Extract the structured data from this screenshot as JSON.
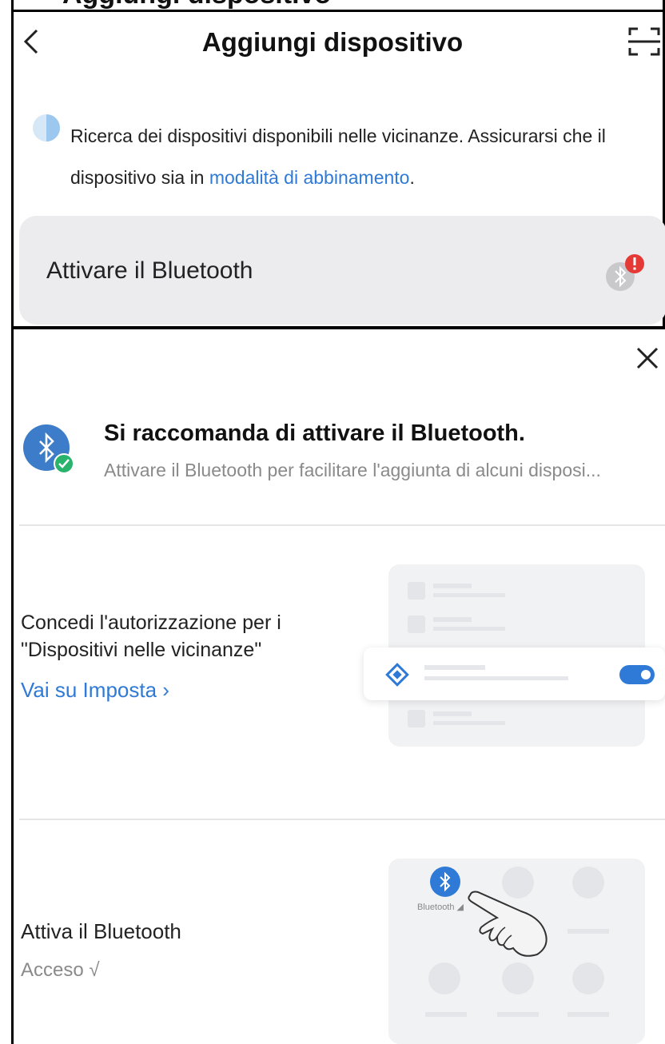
{
  "header": {
    "title": "Aggiungi dispositivo",
    "partial_top_text": "Aggiungi dispositivo"
  },
  "info": {
    "text_before": "Ricerca dei dispositivi disponibili nelle vicinanze. Assicurarsi che il dispositivo sia in ",
    "link": "modalità di abbinamento",
    "text_after": "."
  },
  "bt_card": {
    "label": "Attivare il Bluetooth"
  },
  "sheet": {
    "rec_title": "Si raccomanda di attivare il Bluetooth.",
    "rec_subtitle": "Attivare il Bluetooth per facilitare l'aggiunta di alcuni disposi...",
    "permission": {
      "title": "Concedi l'autorizzazione per i \"Dispositivi nelle vicinanze\"",
      "link": "Vai su Imposta"
    },
    "bluetooth": {
      "title": "Attiva il Bluetooth",
      "status": "Acceso",
      "illustration_label": "Bluetooth"
    }
  },
  "colors": {
    "accent": "#2f7ad6",
    "card_bg": "#ececee",
    "alert": "#e53935",
    "success": "#29b36b"
  }
}
